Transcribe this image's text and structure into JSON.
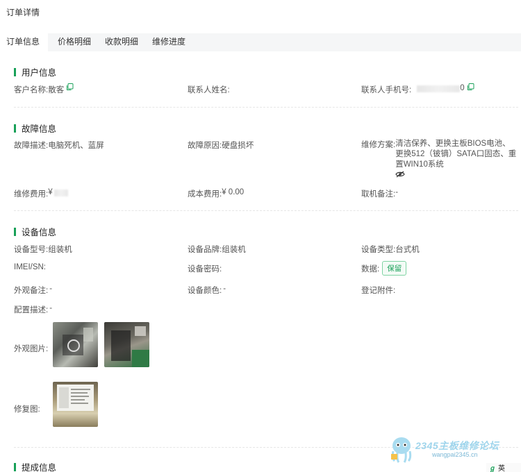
{
  "page": {
    "title": "订单详情"
  },
  "tabs": [
    {
      "label": "订单信息",
      "active": true
    },
    {
      "label": "价格明细"
    },
    {
      "label": "收款明细"
    },
    {
      "label": "维修进度"
    }
  ],
  "user_info": {
    "title": "用户信息",
    "customer_name_label": "客户名称:",
    "customer_name_value": "散客",
    "contact_name_label": "联系人姓名:",
    "contact_phone_label": "联系人手机号:",
    "contact_phone_tail": "0"
  },
  "fault_info": {
    "title": "故障信息",
    "desc_label": "故障描述:",
    "desc_value": "电脑死机、蓝屏",
    "cause_label": "故障原因:",
    "cause_value": "硬盘损坏",
    "plan_label": "维修方案:",
    "plan_value": "清洁保养、更换主板BIOS电池、更换512（铍镝）SATA口固态、重置WIN10系统",
    "fee_label": "维修费用:",
    "fee_value": "¥",
    "cost_label": "成本费用:",
    "cost_value": "¥ 0.00",
    "pickup_note_label": "取机备注:",
    "pickup_note_value": "-"
  },
  "device_info": {
    "title": "设备信息",
    "model_label": "设备型号:",
    "model_value": "组装机",
    "brand_label": "设备品牌:",
    "brand_value": "组装机",
    "type_label": "设备类型:",
    "type_value": "台式机",
    "imei_label": "IMEI/SN:",
    "password_label": "设备密码:",
    "data_label": "数据:",
    "data_tag": "保留",
    "appearance_note_label": "外观备注:",
    "appearance_note_value": "-",
    "color_label": "设备颜色:",
    "color_value": "-",
    "accessories_label": "登记附件:",
    "config_label": "配置描述:",
    "config_value": "-",
    "appearance_photos_label": "外观图片:",
    "repair_photos_label": "修复图:"
  },
  "submit_info": {
    "title": "提成信息"
  },
  "watermark": {
    "text": "2345主板维修论坛",
    "sub": "wangpai2345.cn"
  },
  "ime": {
    "label": "英"
  },
  "colors": {
    "accent": "#18a058",
    "tab_bg": "#f5f6f7",
    "divider": "#e6e6e6"
  }
}
